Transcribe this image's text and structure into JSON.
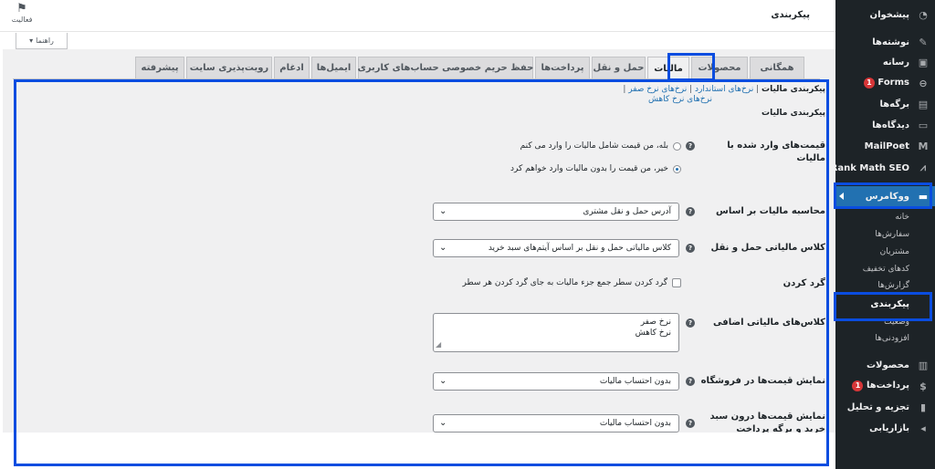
{
  "topbar": {
    "page_title": "پیکربندی",
    "activity_label": "فعالیت",
    "help_label": "راهنما"
  },
  "sidebar": {
    "items": [
      {
        "label": "پیشخوان",
        "icon": "dashboard-icon"
      },
      {
        "label": "نوشته‌ها",
        "icon": "pin-icon"
      },
      {
        "label": "رسانه",
        "icon": "media-icon"
      },
      {
        "label": "Forms",
        "icon": "forms-icon",
        "badge": "1"
      },
      {
        "label": "برگه‌ها",
        "icon": "pages-icon"
      },
      {
        "label": "دیدگاه‌ها",
        "icon": "comments-icon"
      },
      {
        "label": "MailPoet",
        "icon": "mailpoet-icon"
      },
      {
        "label": "Rank Math SEO",
        "icon": "rankmath-icon"
      },
      {
        "label": "ووکامرس",
        "icon": "woo-icon"
      },
      {
        "label": "محصولات",
        "icon": "products-icon"
      },
      {
        "label": "پرداخت‌ها",
        "icon": "payments-icon",
        "badge": "1"
      },
      {
        "label": "تجزیه و تحلیل",
        "icon": "analytics-icon"
      },
      {
        "label": "بازاریابی",
        "icon": "marketing-icon"
      }
    ],
    "submenu": [
      "خانه",
      "سفارش‌ها",
      "مشتریان",
      "کدهای تخفیف",
      "گزارش‌ها",
      "پیکربندی",
      "وضعیت",
      "افزودنی‌ها"
    ]
  },
  "tabs": [
    "همگانی",
    "محصولات",
    "مالیات",
    "حمل و نقل",
    "پرداخت‌ها",
    "حفظ حریم خصوصی حساب‌های کاربری",
    "ایمیل‌ها",
    "ادغام",
    "رویت‌پذیری سایت",
    "پیشرفته"
  ],
  "subsub": {
    "current": "پیکربندی مالیات",
    "links": [
      "نرخ‌های استاندارد",
      "نرخ‌های نرخ صفر",
      "نرخ‌های نرخ کاهش"
    ]
  },
  "section_title": "پیکربندی مالیات",
  "settings": {
    "prices_entered_label": "قیمت‌های وارد شده با مالیات",
    "radio_yes": "بله، من قیمت شامل مالیات را وارد می کنم",
    "radio_no": "خیر، من قیمت را بدون مالیات وارد خواهم کرد",
    "calc_based_label": "محاسبه مالیات بر اساس",
    "calc_based_value": "آدرس حمل و نقل مشتری",
    "shipping_class_label": "کلاس مالیاتی حمل و نقل",
    "shipping_class_value": "کلاس مالیاتی حمل و نقل بر اساس آیتم‌های سبد خرید",
    "rounding_label": "گرد کردن",
    "rounding_checkbox": "گرد کردن سطر جمع جزء مالیات به جای گرد کردن هر سطر",
    "additional_classes_label": "کلاس‌های مالیاتی اضافی",
    "additional_classes_value": [
      "نرخ صفر",
      "نرخ کاهش"
    ],
    "display_shop_label": "نمایش قیمت‌ها در فروشگاه",
    "display_shop_value": "بدون احتساب مالیات",
    "display_cart_label": "نمایش قیمت‌ها درون سبد خرید و برگه پرداخت",
    "display_cart_value": "بدون احتساب مالیات"
  },
  "colors": {
    "sidebar_bg": "#1d2327",
    "accent": "#2271b1",
    "highlight_box": "#0a4de0",
    "badge": "#d63638"
  }
}
